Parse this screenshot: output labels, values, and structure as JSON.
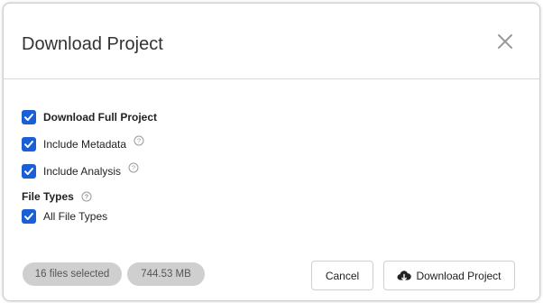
{
  "dialog": {
    "title": "Download Project"
  },
  "options": [
    {
      "label": "Download Full Project",
      "checked": true,
      "bold": true,
      "help": false
    },
    {
      "label": "Include Metadata",
      "checked": true,
      "bold": false,
      "help": true
    },
    {
      "label": "Include Analysis",
      "checked": true,
      "bold": false,
      "help": true
    }
  ],
  "file_types": {
    "label": "File Types",
    "all_label": "All File Types"
  },
  "footer": {
    "files_selected": "16 files selected",
    "size": "744.53 MB",
    "cancel_label": "Cancel",
    "download_label": "Download Project"
  },
  "colors": {
    "checkbox": "#1a5fd6",
    "pill": "#cfcfcf"
  },
  "icons": {
    "close": "close-icon",
    "help": "help-icon",
    "download": "cloud-download-icon"
  }
}
